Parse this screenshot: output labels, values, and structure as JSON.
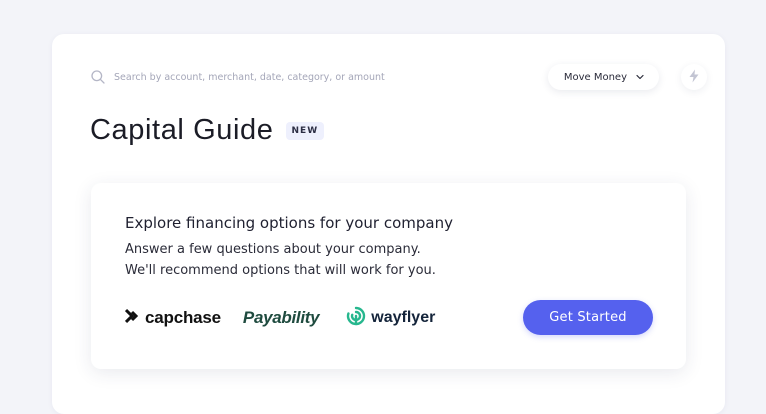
{
  "header": {
    "search_placeholder": "Search by account, merchant, date, category, or amount",
    "move_money_label": "Move Money"
  },
  "page": {
    "title": "Capital Guide",
    "badge": "NEW"
  },
  "promo": {
    "heading": "Explore financing options for your company",
    "body_line1": "Answer a few questions about your company.",
    "body_line2": "We'll recommend options that will work for you.",
    "partners": [
      "capchase",
      "Payability",
      "wayflyer"
    ],
    "cta_label": "Get Started"
  },
  "colors": {
    "accent": "#5561ee",
    "badge_bg": "#eef0fd",
    "page_bg": "#f3f4f9"
  },
  "icons": {
    "search": "search-icon",
    "chevron": "chevron-down-icon",
    "bolt": "lightning-icon"
  }
}
